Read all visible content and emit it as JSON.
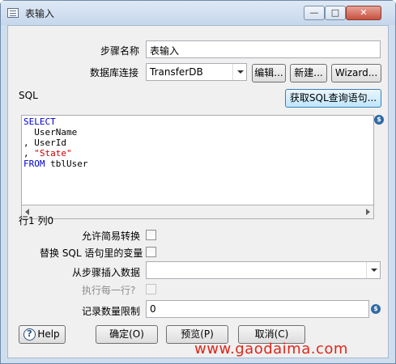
{
  "window": {
    "title": "表输入",
    "min_label": "—",
    "max_label": "□",
    "close_label": "✕"
  },
  "form": {
    "step_name_label": "步骤名称",
    "step_name_value": "表输入",
    "db_conn_label": "数据库连接",
    "db_conn_value": "TransferDB",
    "edit_button": "编辑...",
    "new_button": "新建...",
    "wizard_button": "Wizard...",
    "sql_label": "SQL",
    "get_sql_button": "获取SQL查询语句..."
  },
  "sql": {
    "lines": [
      [
        {
          "t": "SELECT",
          "c": "kw"
        }
      ],
      [
        {
          "t": "  UserName",
          "c": ""
        }
      ],
      [
        {
          "t": ", UserId",
          "c": ""
        }
      ],
      [
        {
          "t": ", ",
          "c": ""
        },
        {
          "t": "\"State\"",
          "c": "str"
        }
      ],
      [
        {
          "t": "FROM",
          "c": "kw"
        },
        {
          "t": " tblUser",
          "c": ""
        }
      ]
    ]
  },
  "status": {
    "cursor": "行1 列0"
  },
  "options": {
    "lazy_conversion_label": "允许简易转换",
    "replace_vars_label": "替换 SQL 语句里的变量",
    "insert_from_step_label": "从步骤插入数据",
    "insert_from_step_value": "",
    "execute_each_row_label": "执行每一行?",
    "limit_label": "记录数量限制",
    "limit_value": "0"
  },
  "buttons": {
    "help": "Help",
    "ok": "确定(O)",
    "preview": "预览(P)",
    "cancel": "取消(C)"
  },
  "watermark": "www.gaodaima.com",
  "icons": {
    "variable": "$"
  }
}
